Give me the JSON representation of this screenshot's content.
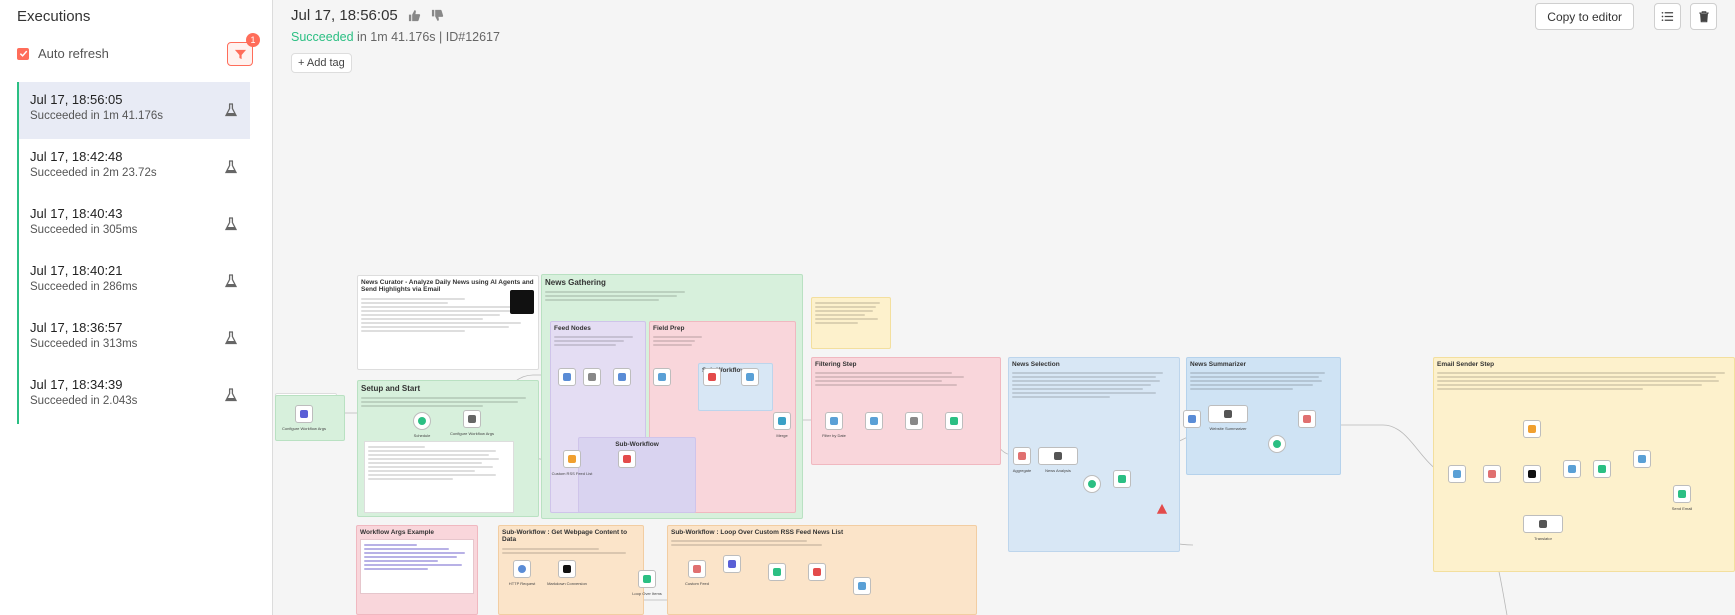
{
  "sidebar": {
    "title": "Executions",
    "auto_refresh_label": "Auto refresh",
    "filter_badge": "1",
    "executions": [
      {
        "time": "Jul 17, 18:56:05",
        "status": "Succeeded in 1m 41.176s"
      },
      {
        "time": "Jul 17, 18:42:48",
        "status": "Succeeded in 2m 23.72s"
      },
      {
        "time": "Jul 17, 18:40:43",
        "status": "Succeeded in 305ms"
      },
      {
        "time": "Jul 17, 18:40:21",
        "status": "Succeeded in 286ms"
      },
      {
        "time": "Jul 17, 18:36:57",
        "status": "Succeeded in 313ms"
      },
      {
        "time": "Jul 17, 18:34:39",
        "status": "Succeeded in 2.043s"
      }
    ]
  },
  "header": {
    "title": "Jul 17, 18:56:05",
    "status_word": "Succeeded",
    "status_detail": " in 1m 41.176s | ID#12617",
    "add_tag": "+ Add tag",
    "copy_to_editor": "Copy to editor"
  },
  "canvas": {
    "notes": {
      "curator_title": "News Curator - Analyze Daily News using AI Agents and Send Highlights via Email",
      "gathering": "News Gathering",
      "feed_nodes": "Feed Nodes",
      "field_prep": "Field Prep",
      "sub_workflow": "Sub-Workflow",
      "setup": "Setup and Start",
      "filtering": "Filtering Step",
      "selection": "News Selection",
      "summarizer": "News Summarizer",
      "email": "Email Sender Step",
      "args_example": "Workflow Args Example",
      "sub_content": "Sub-Workflow : Get Webpage Content to Data",
      "sub_loop": "Sub-Workflow : Loop Over Custom RSS Feed News List"
    },
    "nodes": {
      "configure_args": "Configure Workflow Args",
      "schedule": "Schedule",
      "configure_wf": "Configure Workflow Args",
      "custom_rss": "Custom RSS Feed List",
      "merge": "Merge",
      "filter_date": "Filter by Date",
      "aggregate": "Aggregate",
      "news_analysis": "News Analysis",
      "website_summarizer": "Website Summarizer",
      "translator": "Translator",
      "send_email": "Send Email",
      "http_request": "HTTP Request",
      "markdown": "Markdown Conversion",
      "loop": "Loop Over Items",
      "custom_feed": "Custom Feed"
    }
  },
  "colors": {
    "accent": "#ff6d5a",
    "success": "#2bbf83",
    "selected_bg": "#e8ebf5"
  }
}
